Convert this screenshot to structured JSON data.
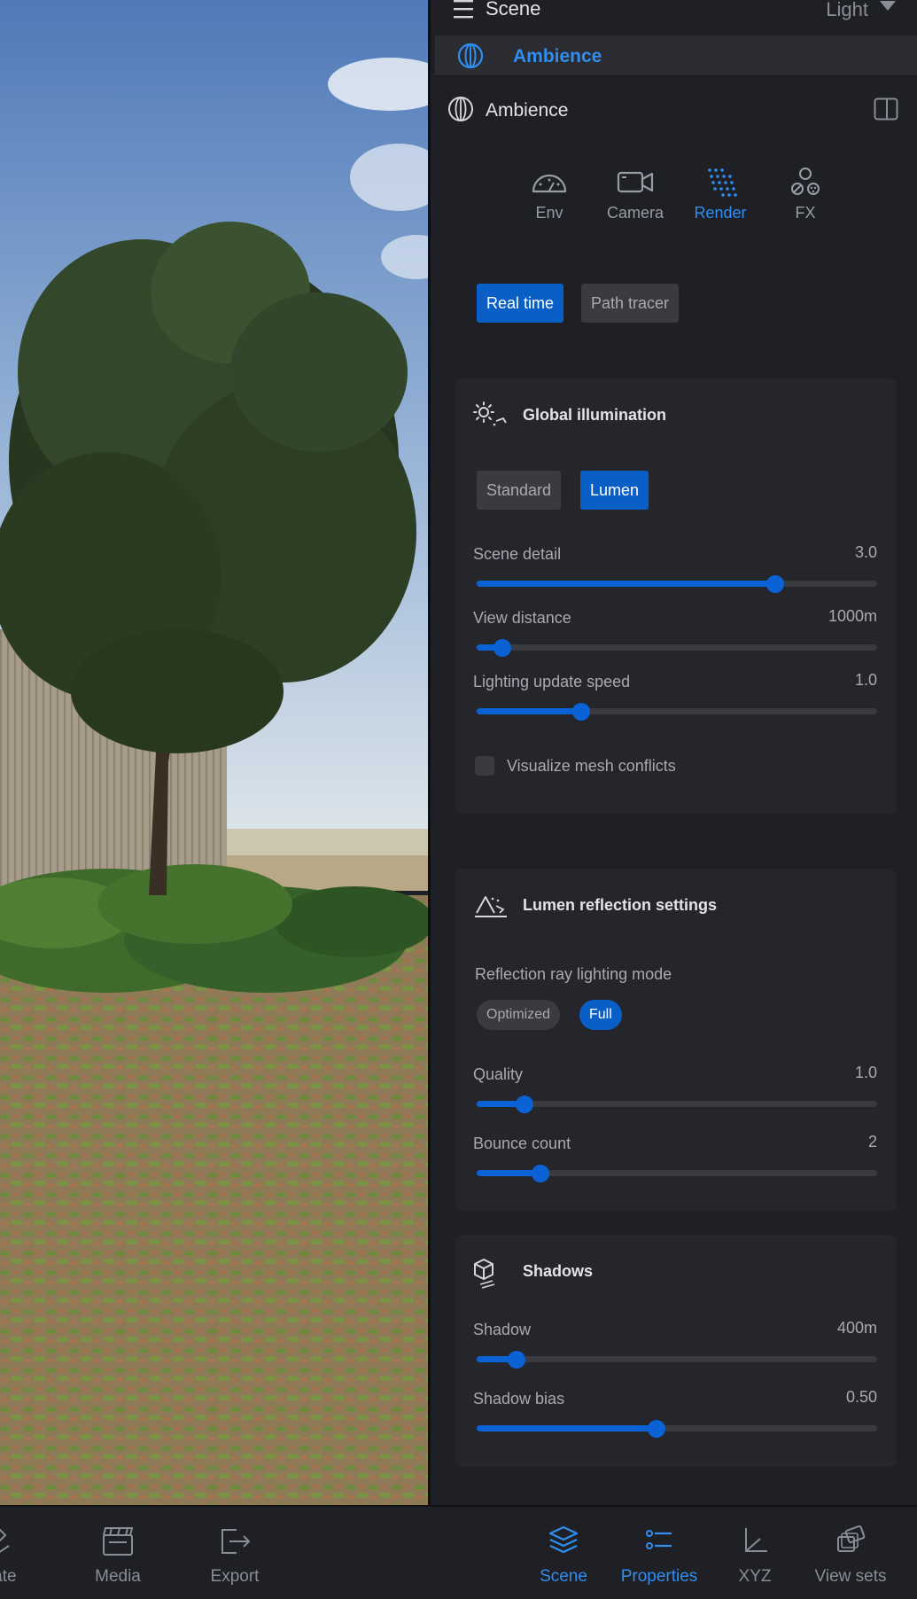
{
  "header": {
    "title": "Scene",
    "theme_label": "Light"
  },
  "breadcrumb": {
    "label": "Ambience"
  },
  "section": {
    "title": "Ambience"
  },
  "tabs": [
    {
      "label": "Env",
      "icon": "gauge-icon",
      "active": false
    },
    {
      "label": "Camera",
      "icon": "video-camera-icon",
      "active": false
    },
    {
      "label": "Render",
      "icon": "dot-grid-icon",
      "active": true
    },
    {
      "label": "FX",
      "icon": "particles-icon",
      "active": false
    }
  ],
  "render_mode": {
    "options": [
      "Real time",
      "Path tracer"
    ],
    "selected": "Real time"
  },
  "global_illumination": {
    "title": "Global illumination",
    "modes": [
      "Standard",
      "Lumen"
    ],
    "selected": "Lumen",
    "sliders": [
      {
        "label": "Scene detail",
        "value": "3.0",
        "fraction": 0.745
      },
      {
        "label": "View distance",
        "value": "1000m",
        "fraction": 0.065
      },
      {
        "label": "Lighting update speed",
        "value": "1.0",
        "fraction": 0.26
      }
    ],
    "checkbox": {
      "label": "Visualize mesh conflicts",
      "checked": false
    }
  },
  "lumen_reflection": {
    "title": "Lumen reflection settings",
    "mode_label": "Reflection ray lighting mode",
    "modes": [
      "Optimized",
      "Full"
    ],
    "selected": "Full",
    "sliders": [
      {
        "label": "Quality",
        "value": "1.0",
        "fraction": 0.12
      },
      {
        "label": "Bounce count",
        "value": "2",
        "fraction": 0.16
      }
    ]
  },
  "shadows": {
    "title": "Shadows",
    "sliders": [
      {
        "label": "Shadow",
        "value": "400m",
        "fraction": 0.1
      },
      {
        "label": "Shadow bias",
        "value": "0.50",
        "fraction": 0.45
      }
    ]
  },
  "bottom_nav": {
    "left": [
      {
        "label": "ulate",
        "icon": "simulate-icon"
      },
      {
        "label": "Media",
        "icon": "clapperboard-icon"
      },
      {
        "label": "Export",
        "icon": "export-icon"
      }
    ],
    "right": [
      {
        "label": "Scene",
        "icon": "layers-icon",
        "active": true
      },
      {
        "label": "Properties",
        "icon": "properties-icon",
        "active": true
      },
      {
        "label": "XYZ",
        "icon": "axes-icon",
        "active": false
      },
      {
        "label": "View sets",
        "icon": "view-sets-icon",
        "active": false
      }
    ]
  },
  "colors": {
    "accent": "#2f8ef0",
    "accent_fill": "#0a5fc7",
    "panel_bg": "#1f2025",
    "card_bg": "#25262b"
  }
}
